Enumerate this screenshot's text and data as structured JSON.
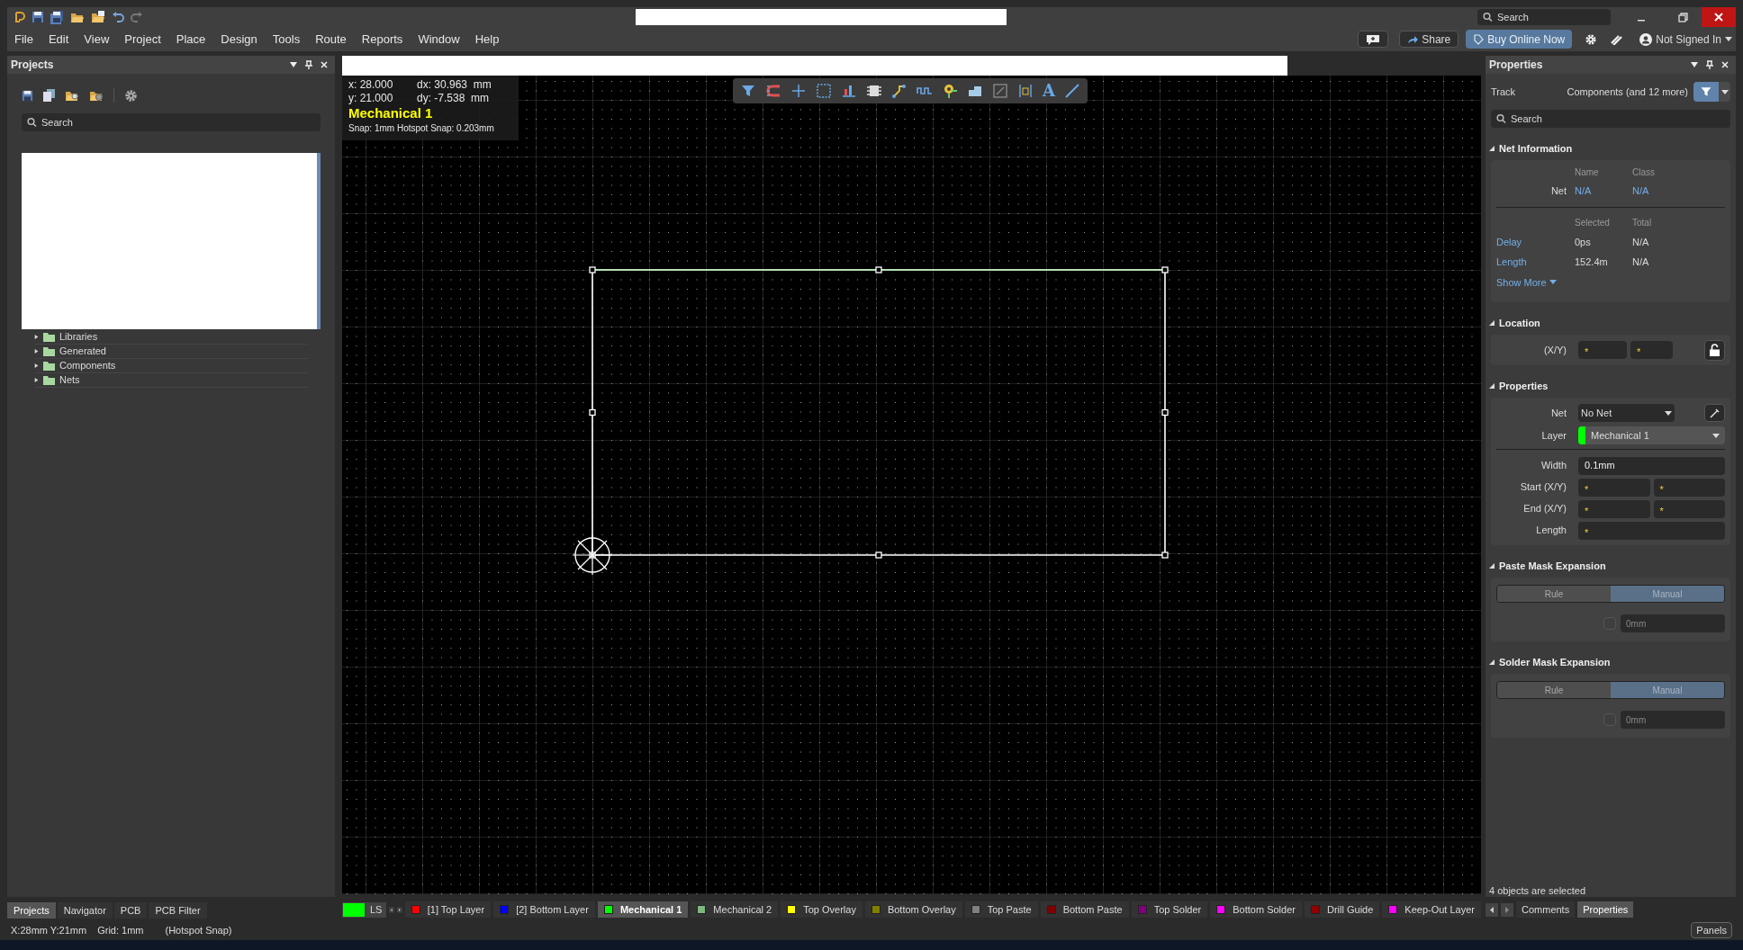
{
  "title_bar": {
    "search_placeholder": "Search"
  },
  "menu": [
    "File",
    "Edit",
    "View",
    "Project",
    "Place",
    "Design",
    "Tools",
    "Route",
    "Reports",
    "Window",
    "Help"
  ],
  "header_buttons": {
    "share": "Share",
    "buy": "Buy Online Now",
    "account": "Not Signed In"
  },
  "projects_panel": {
    "title": "Projects",
    "search_placeholder": "Search",
    "tree": [
      {
        "label": "Libraries",
        "expanded": false
      },
      {
        "label": "Generated",
        "expanded": false
      },
      {
        "label": "Components",
        "expanded": false
      },
      {
        "label": "Nets",
        "expanded": false
      }
    ],
    "tabs": [
      {
        "label": "Projects",
        "selected": true
      },
      {
        "label": "Navigator",
        "selected": false
      },
      {
        "label": "PCB",
        "selected": false
      },
      {
        "label": "PCB Filter",
        "selected": false
      }
    ]
  },
  "canvas": {
    "readout": {
      "x": "x: 28.000",
      "dx": "dx: 30.963  mm",
      "y": "y: 21.000",
      "dy": "dy: -7.538  mm",
      "layer": "Mechanical 1",
      "snap": "Snap: 1mm Hotspot Snap: 0.203mm"
    },
    "toolbar": [
      {
        "kind": "filter"
      },
      {
        "kind": "magnet"
      },
      {
        "kind": "cross"
      },
      {
        "kind": "select"
      },
      {
        "kind": "chart"
      },
      {
        "kind": "chip"
      },
      {
        "kind": "route"
      },
      {
        "kind": "wave"
      },
      {
        "kind": "pin"
      },
      {
        "kind": "fill"
      },
      {
        "kind": "box"
      },
      {
        "kind": "dimension"
      },
      {
        "kind": "glyph",
        "glyph": "A"
      },
      {
        "kind": "line"
      }
    ]
  },
  "layer_bar": {
    "current": {
      "label": "LS",
      "color": "#00ff00"
    },
    "layers": [
      {
        "label": "[1] Top Layer",
        "color": "#ff0000",
        "selected": false
      },
      {
        "label": "[2] Bottom Layer",
        "color": "#0000ff",
        "selected": false
      },
      {
        "label": "Mechanical 1",
        "color": "#00ff00",
        "selected": true
      },
      {
        "label": "Mechanical 2",
        "color": "#7fb77f",
        "selected": false
      },
      {
        "label": "Top Overlay",
        "color": "#ffff00",
        "selected": false
      },
      {
        "label": "Bottom Overlay",
        "color": "#808000",
        "selected": false
      },
      {
        "label": "Top Paste",
        "color": "#808080",
        "selected": false
      },
      {
        "label": "Bottom Paste",
        "color": "#800000",
        "selected": false
      },
      {
        "label": "Top Solder",
        "color": "#800080",
        "selected": false
      },
      {
        "label": "Bottom Solder",
        "color": "#ff00ff",
        "selected": false
      },
      {
        "label": "Drill Guide",
        "color": "#900000",
        "selected": false
      },
      {
        "label": "Keep-Out Layer",
        "color": "#ff00ff",
        "selected": false
      }
    ]
  },
  "properties": {
    "title": "Properties",
    "object": "Track",
    "filter": "Components (and 12 more)",
    "search_placeholder": "Search",
    "sections": [
      {
        "kind": "net_info",
        "title": "Net Information",
        "expanded": true,
        "name_header": "Name",
        "class_header": "Class",
        "net_label": "Net",
        "net_name": "N/A",
        "net_class": "N/A",
        "selected_header": "Selected",
        "total_header": "Total",
        "rows": [
          {
            "label": "Delay",
            "selected_value": "0ps",
            "total_value": "N/A"
          },
          {
            "label": "Length",
            "selected_value": "152.4m",
            "total_value": "N/A"
          }
        ],
        "show_more": "Show More"
      },
      {
        "kind": "location",
        "title": "Location",
        "expanded": true,
        "label": "(X/Y)",
        "x": "*",
        "y": "*",
        "locked": false
      },
      {
        "kind": "properties",
        "title": "Properties",
        "expanded": true,
        "net_label": "Net",
        "net": "No Net",
        "layer_label": "Layer",
        "layer": "Mechanical 1",
        "color": "#00ff00",
        "fields": [
          {
            "label": "Width",
            "values": [
              "0.1mm"
            ]
          },
          {
            "label": "Start (X/Y)",
            "values": [
              "*",
              "*"
            ]
          },
          {
            "label": "End (X/Y)",
            "values": [
              "*",
              "*"
            ]
          },
          {
            "label": "Length",
            "values": [
              "*"
            ]
          }
        ]
      },
      {
        "kind": "mask",
        "title": "Paste Mask Expansion",
        "expanded": true,
        "options": [
          {
            "label": "Rule",
            "selected": false
          },
          {
            "label": "Manual",
            "selected": true
          }
        ],
        "checked": false,
        "value": "0mm"
      },
      {
        "kind": "mask",
        "title": "Solder Mask Expansion",
        "expanded": true,
        "options": [
          {
            "label": "Rule",
            "selected": false
          },
          {
            "label": "Manual",
            "selected": true
          }
        ],
        "checked": false,
        "value": "0mm"
      }
    ],
    "selection_note": "4 objects are selected",
    "tabs": [
      {
        "label": "Comments",
        "selected": false
      },
      {
        "label": "Properties",
        "selected": true
      }
    ],
    "panels_button": "Panels"
  },
  "status_bar": {
    "position": "X:28mm Y:21mm",
    "grid": "Grid: 1mm",
    "snap": "(Hotspot Snap)"
  }
}
